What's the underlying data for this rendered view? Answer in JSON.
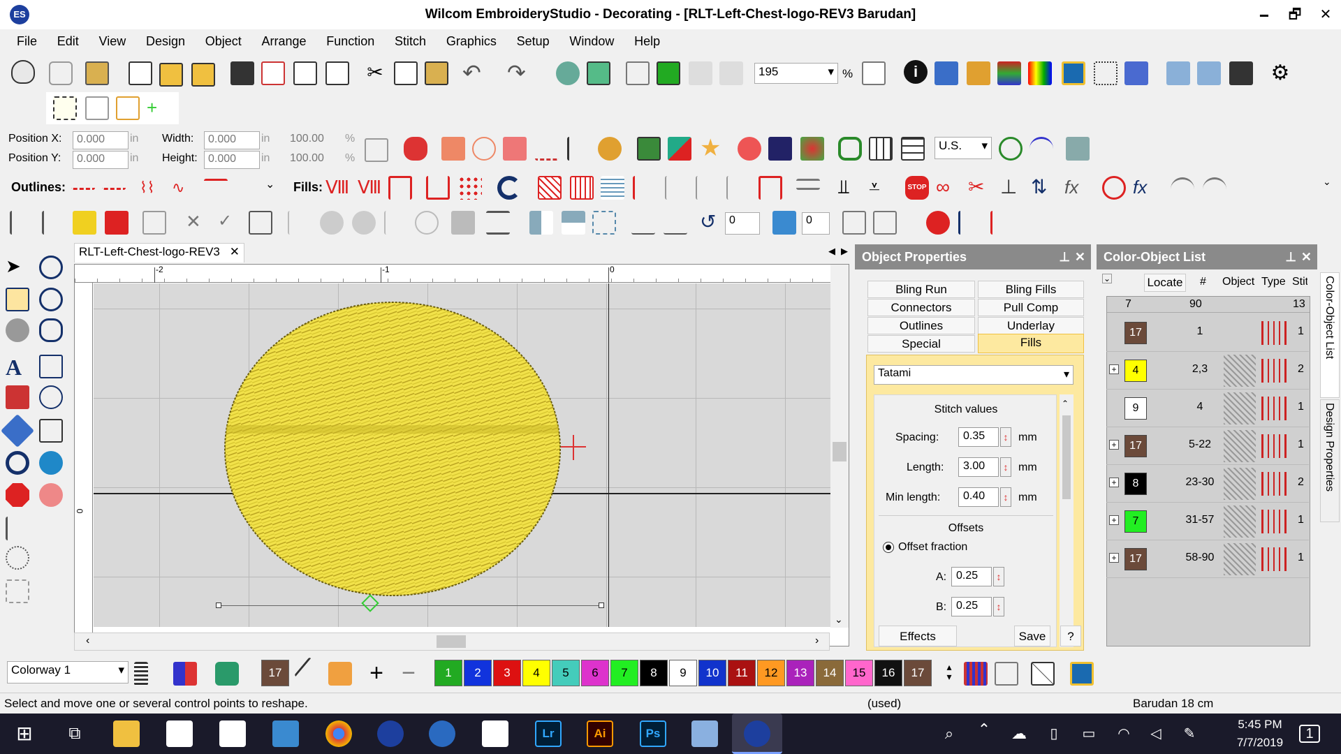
{
  "window": {
    "title": "Wilcom EmbroideryStudio - Decorating - [RLT-Left-Chest-logo-REV3          Barudan]",
    "app_icon": "wilcom-es-icon",
    "minimize": "🗕",
    "restore": "🗗",
    "close": "✕"
  },
  "menu": [
    "File",
    "Edit",
    "View",
    "Design",
    "Object",
    "Arrange",
    "Function",
    "Stitch",
    "Graphics",
    "Setup",
    "Window",
    "Help"
  ],
  "zoom": {
    "value": "195",
    "unit": "%"
  },
  "position": {
    "x_label": "Position X:",
    "x_value": "0.000",
    "x_unit": "in",
    "y_label": "Position Y:",
    "y_value": "0.000",
    "y_unit": "in",
    "w_label": "Width:",
    "w_value": "0.000",
    "w_unit": "in",
    "h_label": "Height:",
    "h_value": "0.000",
    "h_unit": "in",
    "w_pct": "100.00",
    "h_pct": "100.00",
    "pct": "%"
  },
  "lettering": {
    "font_select": "U.S."
  },
  "outlines_label": "Outlines:",
  "fills_label": "Fills:",
  "rotate": {
    "angle": "0",
    "skew": "0"
  },
  "doc_tab": {
    "label": "RLT-Left-Chest-logo-REV3",
    "close": "✕"
  },
  "ruler": {
    "marks": [
      "-2",
      "-1",
      "0"
    ],
    "v_mark": "0"
  },
  "object_properties": {
    "title": "Object Properties",
    "tabs": [
      "Bling Run",
      "Bling Fills",
      "Connectors",
      "Pull Comp",
      "Outlines",
      "Underlay",
      "Special",
      "Fills"
    ],
    "fill_type": "Tatami",
    "stitch_values_title": "Stitch values",
    "spacing_label": "Spacing:",
    "spacing": "0.35",
    "length_label": "Length:",
    "length": "3.00",
    "minlength_label": "Min length:",
    "minlength": "0.40",
    "unit": "mm",
    "offsets_title": "Offsets",
    "offset_fraction_label": "Offset fraction",
    "a_label": "A:",
    "a": "0.25",
    "b_label": "B:",
    "b": "0.25",
    "effects_btn": "Effects",
    "save_btn": "Save",
    "help_btn": "?"
  },
  "color_object_list": {
    "title": "Color-Object List",
    "locate_btn": "Locate",
    "headers": [
      "#",
      "Object",
      "Type",
      "Stitch"
    ],
    "summary": {
      "colors": "7",
      "stitches": "90",
      "types": "13"
    },
    "rows": [
      {
        "color": "17",
        "swatch": "#6b4a3a",
        "text": "#fff",
        "range": "1",
        "object": "ellipse-outline",
        "type_color": "#cc2222",
        "extra": "1",
        "expand": ""
      },
      {
        "color": "4",
        "swatch": "#ffff00",
        "text": "#000",
        "range": "2,3",
        "object": "",
        "type_color": "#cc2222",
        "extra": "2",
        "expand": "+"
      },
      {
        "color": "9",
        "swatch": "#ffffff",
        "text": "#000",
        "range": "4",
        "object": "",
        "type_color": "#cc2222",
        "extra": "1",
        "expand": ""
      },
      {
        "color": "17",
        "swatch": "#6b4a3a",
        "text": "#fff",
        "range": "5-22",
        "object": "",
        "type_color": "#cc2222",
        "extra": "1",
        "expand": "+"
      },
      {
        "color": "8",
        "swatch": "#000000",
        "text": "#fff",
        "range": "23-30",
        "object": "",
        "type_color": "#cc2222",
        "extra": "2",
        "expand": "+"
      },
      {
        "color": "7",
        "swatch": "#22ee22",
        "text": "#000",
        "range": "31-57",
        "object": "",
        "type_color": "#cc2222",
        "extra": "1",
        "expand": "+"
      },
      {
        "color": "17",
        "swatch": "#6b4a3a",
        "text": "#fff",
        "range": "58-90",
        "object": "",
        "type_color": "#cc2222",
        "extra": "1",
        "expand": "+"
      }
    ]
  },
  "side_tabs": {
    "color_object": "Color-Object List",
    "design_props": "Design Properties"
  },
  "colorway": {
    "label": "Colorway 1",
    "current": "17"
  },
  "palette": [
    {
      "n": "1",
      "c": "#22aa22",
      "t": "#fff"
    },
    {
      "n": "2",
      "c": "#1133dd",
      "t": "#fff"
    },
    {
      "n": "3",
      "c": "#dd1111",
      "t": "#fff"
    },
    {
      "n": "4",
      "c": "#ffff00",
      "t": "#000"
    },
    {
      "n": "5",
      "c": "#44ccbb",
      "t": "#000"
    },
    {
      "n": "6",
      "c": "#dd33cc",
      "t": "#000"
    },
    {
      "n": "7",
      "c": "#22ee22",
      "t": "#000"
    },
    {
      "n": "8",
      "c": "#000000",
      "t": "#fff"
    },
    {
      "n": "9",
      "c": "#ffffff",
      "t": "#000"
    },
    {
      "n": "10",
      "c": "#1133cc",
      "t": "#fff"
    },
    {
      "n": "11",
      "c": "#aa1111",
      "t": "#fff"
    },
    {
      "n": "12",
      "c": "#ff9922",
      "t": "#000"
    },
    {
      "n": "13",
      "c": "#aa22bb",
      "t": "#fff"
    },
    {
      "n": "14",
      "c": "#8a6a3a",
      "t": "#fff"
    },
    {
      "n": "15",
      "c": "#ff66cc",
      "t": "#000"
    },
    {
      "n": "16",
      "c": "#111111",
      "t": "#fff"
    },
    {
      "n": "17",
      "c": "#6b4a3a",
      "t": "#fff"
    }
  ],
  "status": {
    "hint": "Select and move one or several control points to reshape.",
    "used": "(used)",
    "machine": "Barudan 18 cm"
  },
  "taskbar": {
    "time": "5:45 PM",
    "date": "7/7/2019",
    "notif": "1",
    "start": "⊞",
    "task_view": "⧉",
    "search_icon": "⌕"
  }
}
